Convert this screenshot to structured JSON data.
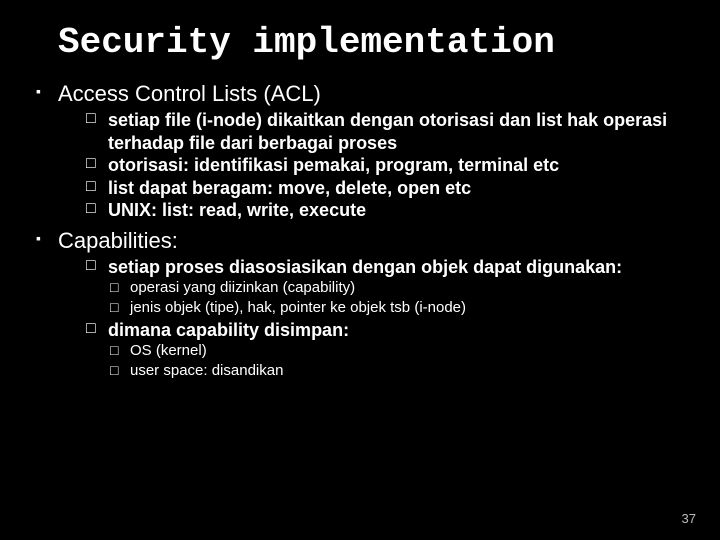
{
  "title": "Security implementation",
  "items": [
    {
      "label": "Access Control Lists (ACL)",
      "children": [
        {
          "label": "setiap file (i-node) dikaitkan dengan otorisasi dan  list hak operasi terhadap file dari berbagai proses"
        },
        {
          "label": "otorisasi: identifikasi pemakai, program, terminal etc"
        },
        {
          "label": "list dapat beragam: move, delete, open etc"
        },
        {
          "label": "UNIX: list: read, write, execute"
        }
      ]
    },
    {
      "label": "Capabilities:",
      "children": [
        {
          "label": "setiap proses diasosiasikan dengan objek dapat digunakan:",
          "children": [
            {
              "label": "operasi yang diizinkan (capability)"
            },
            {
              "label": "jenis objek (tipe), hak, pointer ke objek tsb (i-node)"
            }
          ]
        },
        {
          "label": "dimana capability disimpan:",
          "children": [
            {
              "label": "OS (kernel)"
            },
            {
              "label": "user space: disandikan"
            }
          ]
        }
      ]
    }
  ],
  "page_number": "37"
}
